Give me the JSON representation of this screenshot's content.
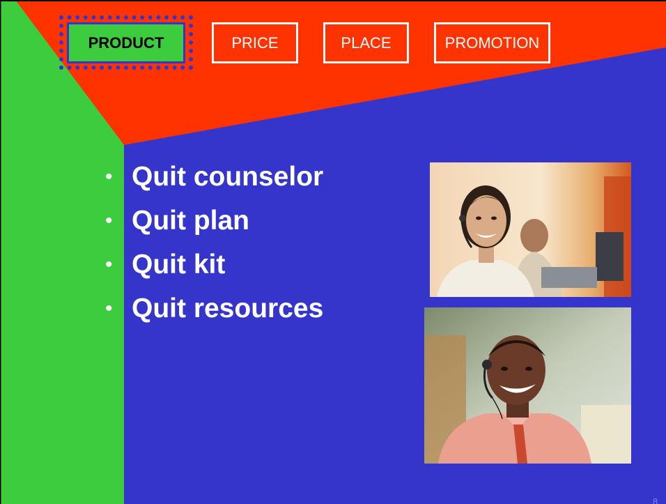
{
  "nav": {
    "product_label": "PRODUCT",
    "price_label": "PRICE",
    "place_label": "PLACE",
    "promotion_label": "PROMOTION",
    "active": "PRODUCT"
  },
  "bullets": [
    {
      "text": "Quit counselor"
    },
    {
      "text": "Quit plan"
    },
    {
      "text": "Quit kit"
    },
    {
      "text": "Quit resources"
    }
  ],
  "page_number": "8",
  "colors": {
    "background": "#3535cc",
    "top_band": "#ff3300",
    "left_band": "#3dcc3d",
    "active_highlight": "#3535cc",
    "text": "#ffffff"
  },
  "icons": {
    "bullet": "bullet-dot-icon",
    "photo_1": "woman-headset-photo",
    "photo_2": "man-headset-photo"
  }
}
